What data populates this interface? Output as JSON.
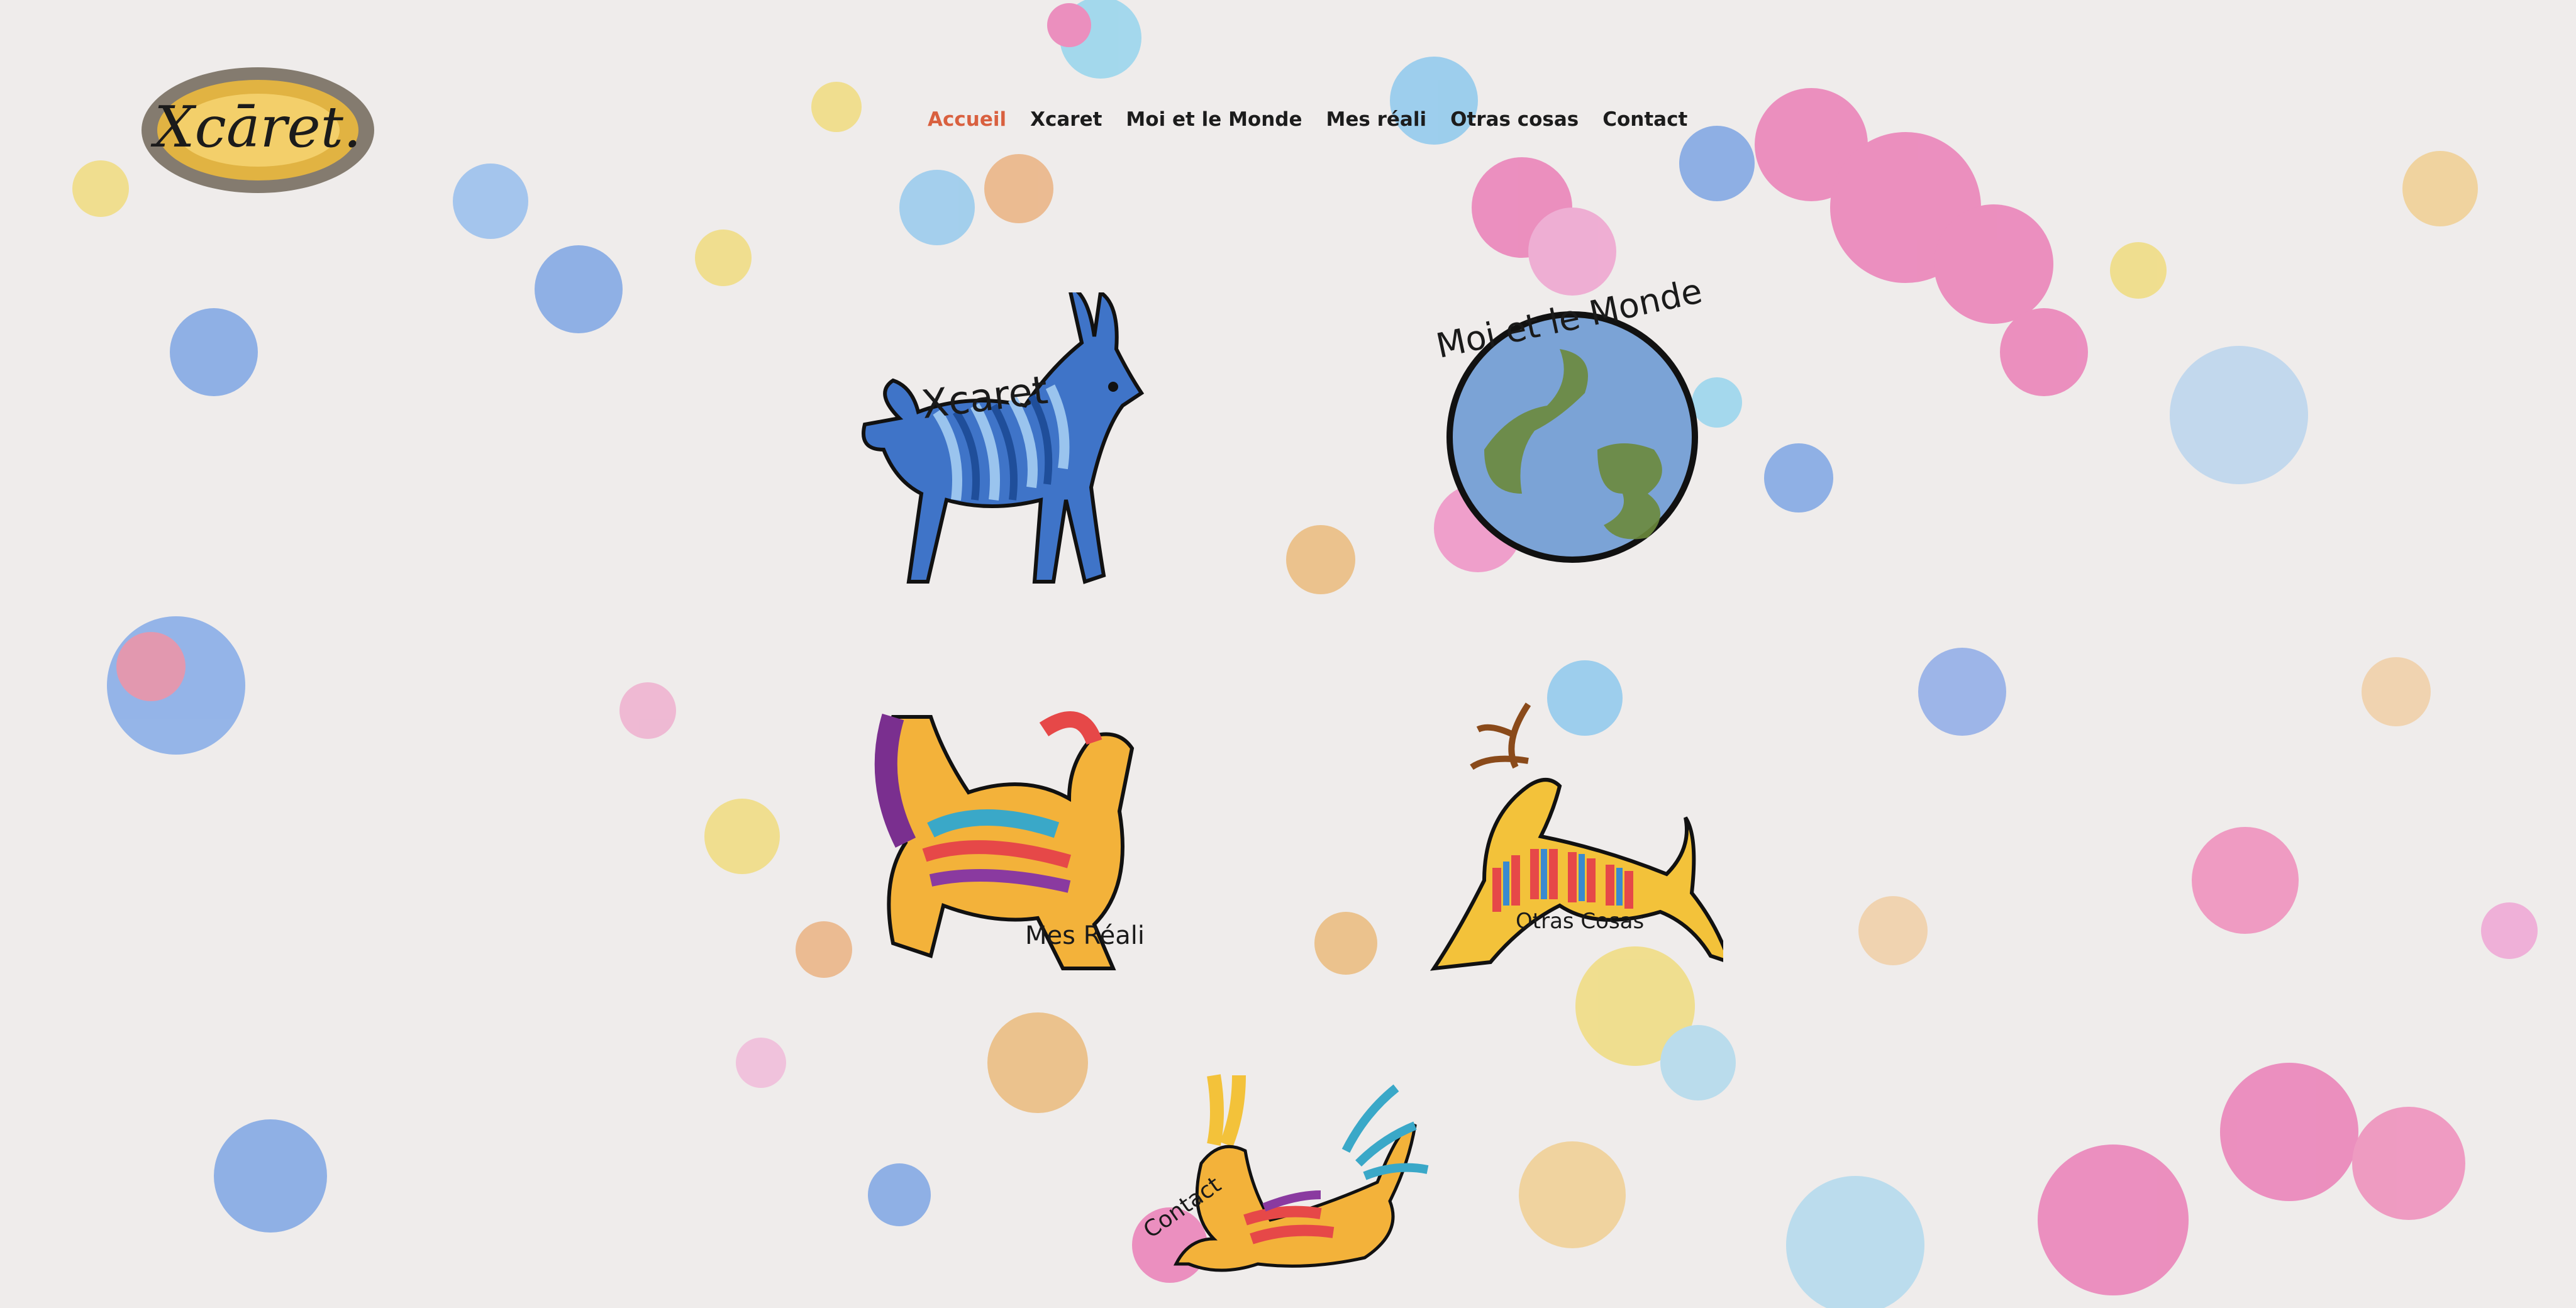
{
  "logo": {
    "text": "Xcāret."
  },
  "nav": {
    "items": [
      {
        "label": "Accueil",
        "active": true
      },
      {
        "label": "Xcaret",
        "active": false
      },
      {
        "label": "Moi et le Monde",
        "active": false
      },
      {
        "label": "Mes réali",
        "active": false
      },
      {
        "label": "Otras cosas",
        "active": false
      },
      {
        "label": "Contact",
        "active": false
      }
    ]
  },
  "tiles": {
    "xcaret": {
      "label": "Xcaret",
      "icon": "blue-llama-icon"
    },
    "moi": {
      "label": "Moi et le Monde",
      "icon": "globe-icon"
    },
    "mesreali": {
      "label": "Mes Réali",
      "icon": "rainbow-dog-icon"
    },
    "otras": {
      "label": "Otras Cosas",
      "icon": "rainbow-deer-icon"
    },
    "contact": {
      "label": "Contact",
      "icon": "rainbow-rabbit-icon"
    }
  },
  "colors": {
    "accent": "#d9603f",
    "text": "#1c1c1c",
    "background": "#efeceb"
  }
}
